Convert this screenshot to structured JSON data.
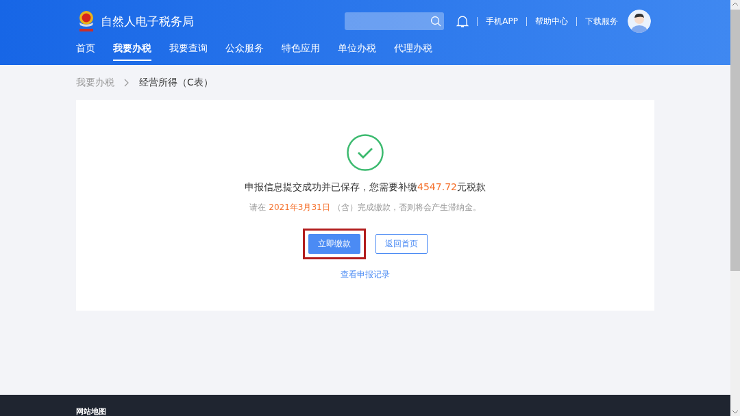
{
  "header": {
    "title": "自然人电子税务局",
    "links": [
      "手机APP",
      "帮助中心",
      "下载服务"
    ]
  },
  "nav": [
    {
      "label": "首页",
      "selected": false
    },
    {
      "label": "我要办税",
      "selected": true
    },
    {
      "label": "我要查询",
      "selected": false
    },
    {
      "label": "公众服务",
      "selected": false
    },
    {
      "label": "特色应用",
      "selected": false
    },
    {
      "label": "单位办税",
      "selected": false
    },
    {
      "label": "代理办税",
      "selected": false
    }
  ],
  "breadcrumb": [
    {
      "label": "我要办税",
      "current": false
    },
    {
      "label": "经营所得（C表）",
      "current": true
    }
  ],
  "result": {
    "message": {
      "before": "申报信息提交成功并已保存，您需要补缴",
      "amount": "4547.72",
      "after": "元税款"
    },
    "notice": {
      "before": "请在",
      "date": "2021年3月31日",
      "after": "（含）完成缴款，否则将会产生滞纳金。"
    },
    "buttons": [
      {
        "label": "立即缴款",
        "kind": "primary",
        "highlighted": true
      },
      {
        "label": "返回首页",
        "kind": "secondary",
        "highlighted": false
      }
    ],
    "link": "查看申报记录"
  },
  "footer": {
    "title": "网站地图"
  }
}
